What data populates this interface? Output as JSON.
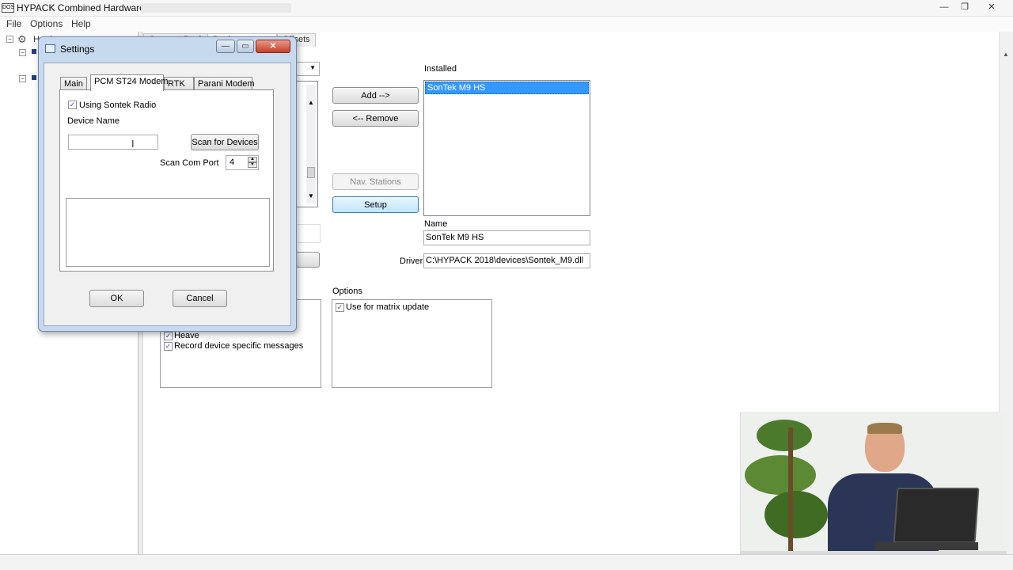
{
  "window": {
    "app_icon_text": "DOS",
    "title": "HYPACK Combined Hardware",
    "minimize": "—",
    "maximize": "❒",
    "close": "✕"
  },
  "menu": [
    "File",
    "Options",
    "Help"
  ],
  "tree": {
    "root_label": "Hardware"
  },
  "background_tabs": [
    "Connect Devices",
    "Devices",
    "Offsets"
  ],
  "devices": {
    "installed_label": "Installed",
    "installed_items": [
      "SonTek M9 HS"
    ],
    "add_button": "Add -->",
    "remove_button": "<-- Remove",
    "nav_stations_button": "Nav. Stations",
    "setup_button": "Setup",
    "name_label": "Name",
    "name_value": "SonTek M9 HS",
    "driver_label": "Driver",
    "driver_value": "C:\\HYPACK 2018\\devices\\Sontek_M9.dll",
    "options_label": "Options",
    "options_items": [
      {
        "label": "Use for matrix update",
        "checked": true
      }
    ],
    "record_items": [
      {
        "label": "Heave",
        "checked": true
      },
      {
        "label": "Record device specific messages",
        "checked": true
      }
    ]
  },
  "dialog": {
    "title": "Settings",
    "tabs": [
      "Main",
      "PCM ST24 Modem",
      "RTK",
      "Parani Modem"
    ],
    "active_tab": "PCM ST24 Modem",
    "using_sontek_radio_label": "Using Sontek Radio",
    "using_sontek_radio_checked": true,
    "device_name_label": "Device Name",
    "device_name_value": "",
    "scan_button": "Scan for Devices",
    "scan_com_port_label": "Scan Com Port",
    "scan_com_port_value": "4",
    "ok_button": "OK",
    "cancel_button": "Cancel"
  },
  "colors": {
    "selection": "#3399ff",
    "dialog_frame": "#c6d9ef",
    "hot_button": "#bee6fd"
  }
}
